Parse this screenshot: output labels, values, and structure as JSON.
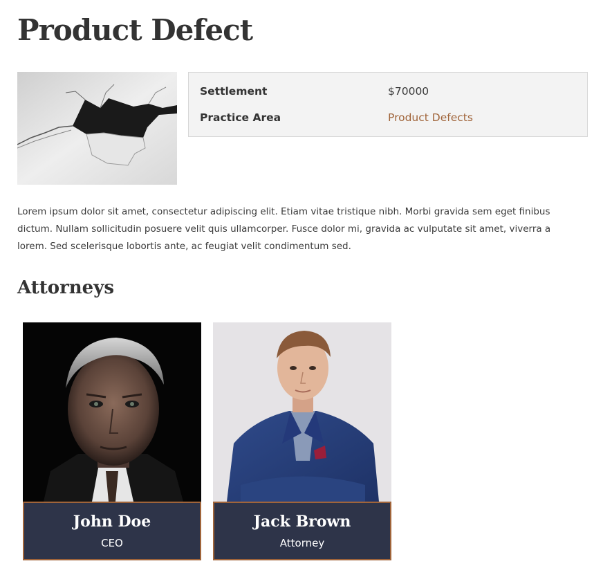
{
  "page": {
    "title": "Product Defect"
  },
  "case_details": {
    "image_icon": "torn-paper-image",
    "rows": [
      {
        "label": "Settlement",
        "value": "$70000"
      },
      {
        "label": "Practice Area",
        "value": "Product Defects"
      }
    ],
    "link_color": "#a0643a"
  },
  "description": "Lorem ipsum dolor sit amet, consectetur adipiscing elit. Etiam vitae tristique nibh. Morbi gravida sem eget finibus dictum. Nullam sollicitudin posuere velit quis ullamcorper. Fusce dolor mi, gravida ac vulputate sit amet, viverra a lorem. Sed scelerisque lobortis ante, ac feugiat velit condimentum sed.",
  "attorneys": {
    "heading": "Attorneys",
    "items": [
      {
        "name": "John Doe",
        "role": "CEO",
        "photo": "portrait-older-man-dark-background"
      },
      {
        "name": "Jack Brown",
        "role": "Attorney",
        "photo": "portrait-young-man-blue-suit"
      }
    ],
    "caption_bg": "#2e3449",
    "caption_border": "#a0643a"
  }
}
